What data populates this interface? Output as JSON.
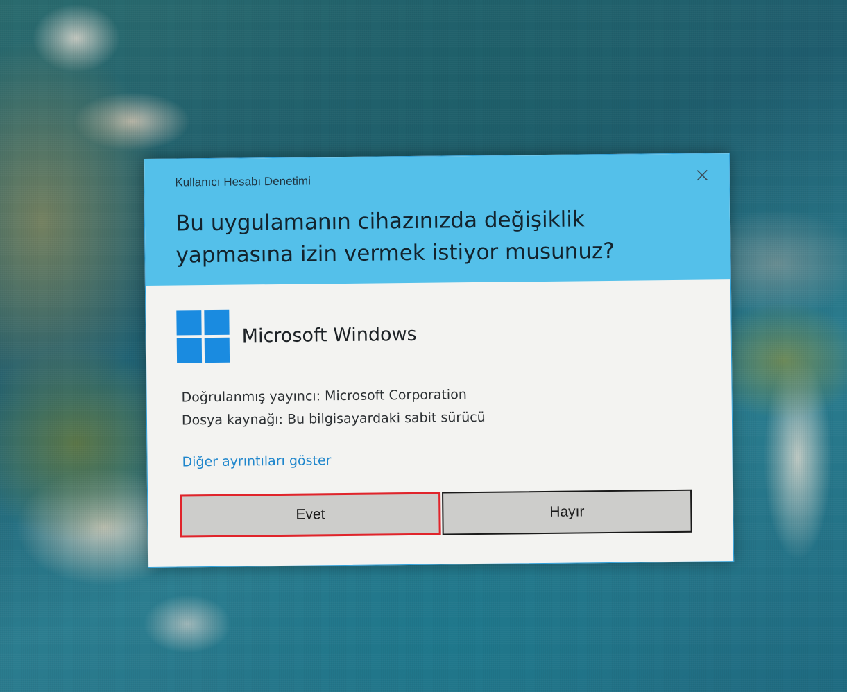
{
  "dialog": {
    "caption": "Kullanıcı Hesabı Denetimi",
    "question_line1": "Bu uygulamanın cihazınızda değişiklik",
    "question_line2": "yapmasına izin vermek istiyor musunuz?",
    "app_name": "Microsoft Windows",
    "publisher_label": "Doğrulanmış yayıncı: Microsoft Corporation",
    "origin_label": "Dosya kaynağı: Bu bilgisayardaki sabit sürücü",
    "details_link": "Diğer ayrıntıları göster",
    "yes_label": "Evet",
    "no_label": "Hayır"
  },
  "colors": {
    "header": "#54c0ea",
    "body": "#f3f3f1",
    "link": "#1f86cc",
    "windows_logo": "#1a8be0",
    "highlight_outline": "#e0242b"
  },
  "icons": {
    "close": "close-icon",
    "logo": "windows-logo-icon"
  }
}
